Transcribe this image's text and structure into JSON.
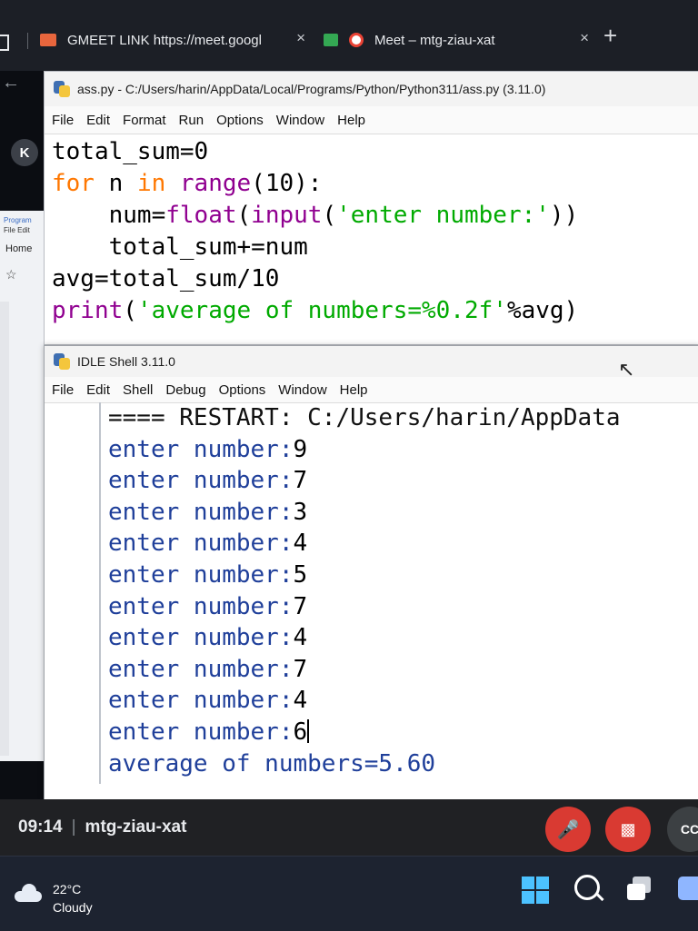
{
  "browser": {
    "tabs": [
      {
        "label": "GMEET LINK https://meet.googl",
        "close": "×"
      },
      {
        "label": "Meet – mtg-ziau-xat",
        "close": "×"
      }
    ],
    "new_tab": "+"
  },
  "background": {
    "avatar_letter": "K",
    "explorer": {
      "title": "Program",
      "menu": "File  Edit",
      "tab": "Home"
    }
  },
  "editor": {
    "title": "ass.py - C:/Users/harin/AppData/Local/Programs/Python/Python311/ass.py (3.11.0)",
    "menu": [
      "File",
      "Edit",
      "Format",
      "Run",
      "Options",
      "Window",
      "Help"
    ],
    "code": {
      "l1": "total_sum=0",
      "l2_kw1": "for",
      "l2_mid": " n ",
      "l2_kw2": "in",
      "l2_sp": " ",
      "l2_bi": "range",
      "l2_rest": "(10):",
      "l3_pre": "    num=",
      "l3_bi1": "float",
      "l3_p1": "(",
      "l3_bi2": "input",
      "l3_p2": "(",
      "l3_str": "'enter number:'",
      "l3_end": "))",
      "l4": "    total_sum+=num",
      "l5": "avg=total_sum/10",
      "l6_bi": "print",
      "l6_p": "(",
      "l6_str": "'average of numbers=%0.2f'",
      "l6_end": "%avg)"
    }
  },
  "shell": {
    "title": "IDLE Shell 3.11.0",
    "menu": [
      "File",
      "Edit",
      "Shell",
      "Debug",
      "Options",
      "Window",
      "Help"
    ],
    "restart_line": "==== RESTART: C:/Users/harin/AppData",
    "prompt": "enter number:",
    "inputs": [
      "9",
      "7",
      "3",
      "4",
      "5",
      "7",
      "4",
      "7",
      "4",
      "6"
    ],
    "result": "average of numbers=5.60"
  },
  "meet": {
    "time": "09:14",
    "separator": "|",
    "meeting_code": "mtg-ziau-xat",
    "cc_label": "CC"
  },
  "taskbar": {
    "temperature": "22°C",
    "condition": "Cloudy"
  },
  "colors": {
    "keyword": "#ff7700",
    "builtin": "#900090",
    "string": "#00aa00",
    "shell_output": "#1f3f9a",
    "meet_red": "#d93a32",
    "windows_blue": "#4cc2ff"
  }
}
